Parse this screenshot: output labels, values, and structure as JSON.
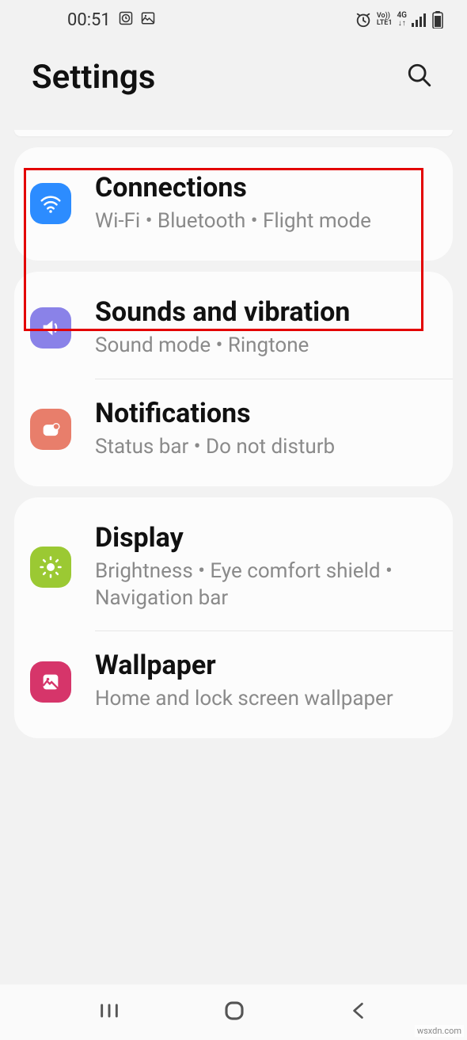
{
  "statusbar": {
    "time": "00:51",
    "volte_top": "Vo))",
    "volte_bottom": "LTE1",
    "net_top": "4G",
    "net_bottom": "↓↑"
  },
  "header": {
    "title": "Settings"
  },
  "groups": [
    {
      "rows": [
        {
          "key": "connections",
          "title": "Connections",
          "subtitle": "Wi‑Fi  •  Bluetooth  •  Flight mode",
          "iconColor": "blue",
          "icon": "wifi-icon"
        }
      ]
    },
    {
      "rows": [
        {
          "key": "sounds",
          "title": "Sounds and vibration",
          "subtitle": "Sound mode  •  Ringtone",
          "iconColor": "purple",
          "icon": "sound-icon"
        },
        {
          "key": "notifications",
          "title": "Notifications",
          "subtitle": "Status bar  •  Do not disturb",
          "iconColor": "coral",
          "icon": "notification-icon"
        }
      ]
    },
    {
      "rows": [
        {
          "key": "display",
          "title": "Display",
          "subtitle": "Brightness  •  Eye comfort shield  •  Navigation bar",
          "iconColor": "green",
          "icon": "brightness-icon"
        },
        {
          "key": "wallpaper",
          "title": "Wallpaper",
          "subtitle": "Home and lock screen wallpaper",
          "iconColor": "pink",
          "icon": "wallpaper-icon"
        }
      ]
    }
  ],
  "watermark": "wsxdn.com"
}
